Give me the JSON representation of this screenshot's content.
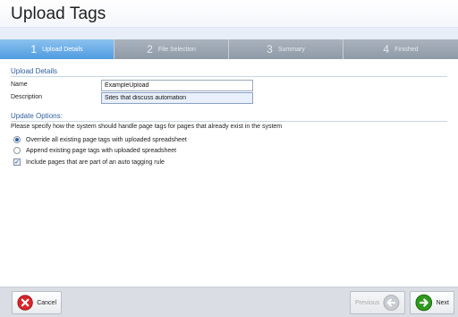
{
  "window": {
    "title": "Upload Tags"
  },
  "wizard_steps": [
    {
      "number": "1",
      "label": "Upload Details",
      "active": true
    },
    {
      "number": "2",
      "label": "File Selection",
      "active": false
    },
    {
      "number": "3",
      "label": "Summary",
      "active": false
    },
    {
      "number": "4",
      "label": "Finished",
      "active": false
    }
  ],
  "upload_details": {
    "heading": "Upload Details",
    "name_label": "Name",
    "name_value": "ExampleUpload",
    "description_label": "Description",
    "description_value": "Sites that discuss automation"
  },
  "update_options": {
    "heading": "Update Options:",
    "instructions": "Please specify how the system should handle page tags for pages that already exist in the system",
    "radio_override": {
      "label": "Override all existing page tags with uploaded spreadsheet",
      "selected": true
    },
    "radio_append": {
      "label": "Append existing page tags with uploaded spreadsheet",
      "selected": false
    },
    "checkbox_auto_tagging": {
      "label": "Include pages that are part of an auto tagging rule",
      "checked": true
    }
  },
  "footer": {
    "cancel_label": "Cancel",
    "previous_label": "Previous",
    "next_label": "Next"
  },
  "colors": {
    "active_step": "#4f9be0",
    "section_heading": "#2f5f9e",
    "cancel_icon": "#d9262b",
    "next_icon": "#2e9a1e"
  },
  "icons": {
    "cancel": "cancel-x-icon",
    "previous": "arrow-left-icon",
    "next": "arrow-right-icon"
  }
}
